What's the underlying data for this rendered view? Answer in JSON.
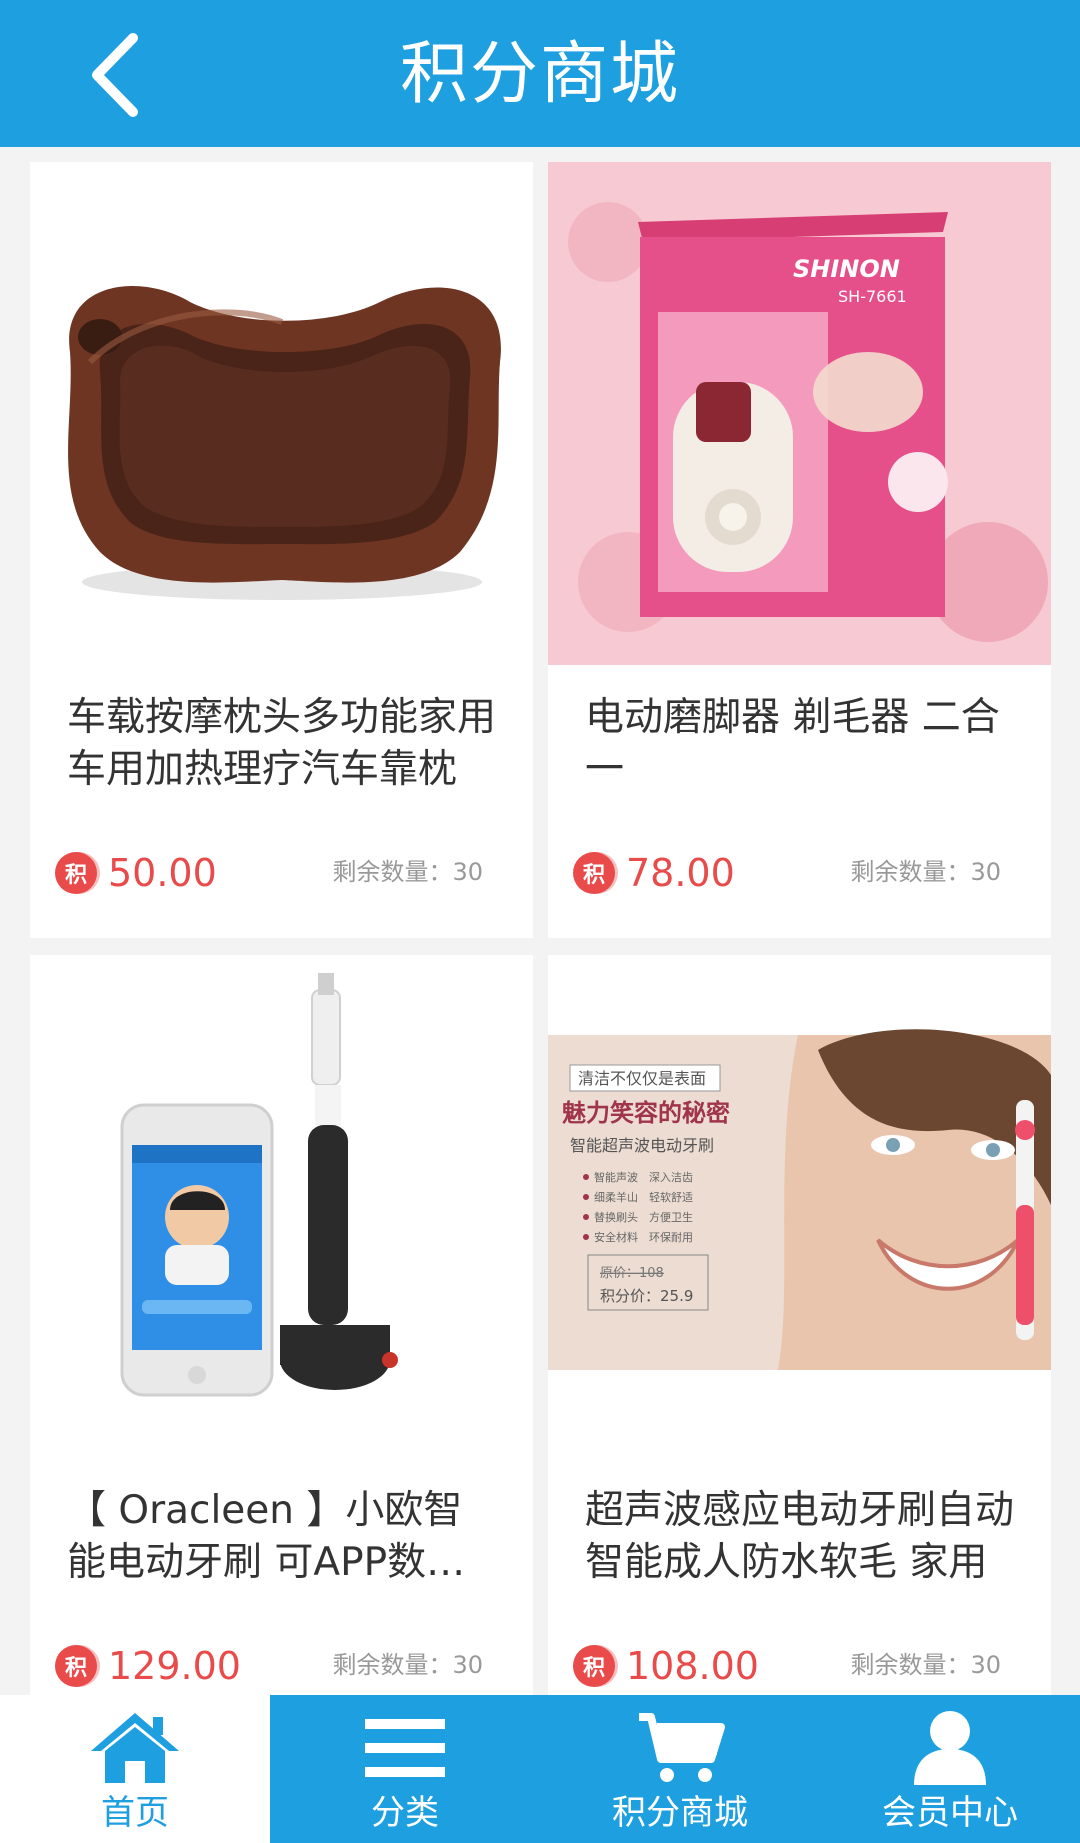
{
  "header": {
    "title": "积分商城"
  },
  "products": [
    {
      "name": "车载按摩枕头多功能家用车用加热理疗汽车靠枕",
      "badge": "积",
      "price": "50.00",
      "stock_label": "剩余数量：30"
    },
    {
      "name": "电动磨脚器 剃毛器 二合一",
      "badge": "积",
      "price": "78.00",
      "stock_label": "剩余数量：30",
      "box_brand": "SHINON",
      "box_model": "SH-7661"
    },
    {
      "name": "【 Oracleen 】小欧智能电动牙刷 可APP数据连接",
      "badge": "积",
      "price": "129.00",
      "stock_label": "剩余数量：30"
    },
    {
      "name": "超声波感应电动牙刷自动智能成人防水软毛 家用",
      "badge": "积",
      "price": "108.00",
      "stock_label": "剩余数量：30",
      "promo": {
        "line1": "清洁不仅仅是表面",
        "line2": "魅力笑容的秘密",
        "line3": "智能超声波电动牙刷",
        "features": [
          "智能声波　深入洁齿",
          "细柔羊山　轻软舒适",
          "替换刷头　方便卫生",
          "安全材料　环保耐用"
        ],
        "original_price": "原价：108",
        "points_price": "积分价：25.9"
      }
    }
  ],
  "tabbar": {
    "items": [
      {
        "label": "首页",
        "icon": "home-icon"
      },
      {
        "label": "分类",
        "icon": "menu-icon"
      },
      {
        "label": "积分商城",
        "icon": "cart-icon"
      },
      {
        "label": "会员中心",
        "icon": "user-icon"
      }
    ]
  },
  "colors": {
    "primary": "#1e9fe0",
    "price": "#e94b4b",
    "background": "#f3f3f3"
  }
}
